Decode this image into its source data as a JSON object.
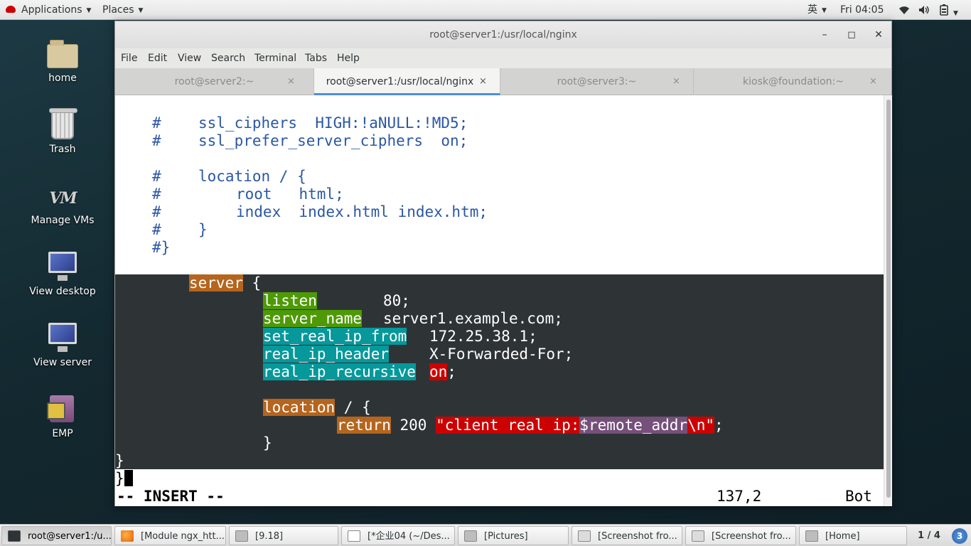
{
  "top_panel": {
    "applications": "Applications",
    "places": "Places",
    "input_method": "英",
    "clock": "Fri 04:05"
  },
  "desktop_icons": [
    {
      "label": "home",
      "icon": "home-folder-icon"
    },
    {
      "label": "Trash",
      "icon": "trash-icon"
    },
    {
      "label": "Manage VMs",
      "icon": "vm-icon"
    },
    {
      "label": "View desktop",
      "icon": "monitor-icon"
    },
    {
      "label": "View server",
      "icon": "monitor-icon"
    },
    {
      "label": "EMP",
      "icon": "emp-icon"
    }
  ],
  "terminal": {
    "title": "root@server1:/usr/local/nginx",
    "menu": [
      "File",
      "Edit",
      "View",
      "Search",
      "Terminal",
      "Tabs",
      "Help"
    ],
    "tabs": [
      {
        "label": "root@server2:~",
        "active": false
      },
      {
        "label": "root@server1:/usr/local/nginx",
        "active": true
      },
      {
        "label": "root@server3:~",
        "active": false
      },
      {
        "label": "kiosk@foundation:~",
        "active": false
      }
    ],
    "close_glyph": "×",
    "lines": {
      "l1_hash": "#",
      "l1_text": "ssl_ciphers  HIGH:!aNULL:!MD5;",
      "l2_hash": "#",
      "l2_text": "ssl_prefer_server_ciphers  on;",
      "l3_hash": "#",
      "l3_text": "location / {",
      "l4_hash": "#",
      "l4_text": "root   html;",
      "l5_hash": "#",
      "l5_text": "index  index.html index.htm;",
      "l6_hash": "#",
      "l6_text": "}",
      "l7_text": "#}",
      "server_kw": "server",
      "server_brace": " {",
      "listen_kw": "listen",
      "listen_val": "80;",
      "server_name_kw": "server_name",
      "server_name_val": "server1.example.com;",
      "set_real_ip_kw": "set_real_ip_from",
      "set_real_ip_val": "172.25.38.1;",
      "real_ip_header_kw": "real_ip_header",
      "real_ip_header_val": "X-Forwarded-For;",
      "real_ip_recursive_kw": "real_ip_recursive",
      "real_ip_recursive_val": "on",
      "semicolon": ";",
      "location_kw": "location",
      "location_rest": " / {",
      "return_kw": "return",
      "return_code": " 200 ",
      "return_str_a": "\"client real ip:",
      "return_var": "$remote_addr",
      "return_str_b": "\\n\"",
      "inner_close": "}",
      "server_close": "}",
      "last_close": "}"
    },
    "status": {
      "mode": "-- INSERT --",
      "position": "137,2",
      "scroll": "Bot"
    }
  },
  "taskbar": {
    "tasks": [
      {
        "label": "root@server1:/u...",
        "icon": "terminal-icon",
        "active": true
      },
      {
        "label": "[Module ngx_htt...",
        "icon": "firefox-icon",
        "active": false
      },
      {
        "label": "[9.18]",
        "icon": "window-icon",
        "active": false
      },
      {
        "label": "[*企业04 (~/Des...",
        "icon": "editor-icon",
        "active": false
      },
      {
        "label": "[Pictures]",
        "icon": "folder-icon",
        "active": false
      },
      {
        "label": "[Screenshot fro...",
        "icon": "screenshot-icon",
        "active": false
      },
      {
        "label": "[Screenshot fro...",
        "icon": "screenshot-icon",
        "active": false
      },
      {
        "label": "[Home]",
        "icon": "folder-icon",
        "active": false
      }
    ],
    "pager": "1 / 4",
    "notifications": "3"
  }
}
